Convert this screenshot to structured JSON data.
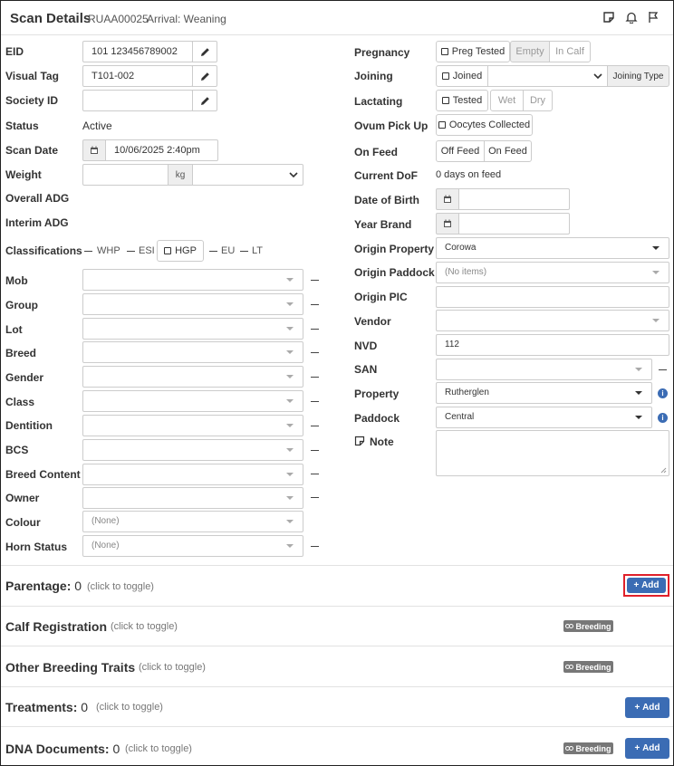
{
  "header": {
    "title": "Scan Details",
    "animal_id": "RUAA00025",
    "arrival": "Arrival: Weaning"
  },
  "left": {
    "eid": {
      "label": "EID",
      "value": "101 123456789002"
    },
    "visual_tag": {
      "label": "Visual Tag",
      "value": "T101-002"
    },
    "society_id": {
      "label": "Society ID",
      "value": ""
    },
    "status": {
      "label": "Status",
      "value": "Active"
    },
    "scan_date": {
      "label": "Scan Date",
      "value": "10/06/2025 2:40pm"
    },
    "weight": {
      "label": "Weight",
      "unit": "kg"
    },
    "overall_adg": {
      "label": "Overall ADG"
    },
    "interim_adg": {
      "label": "Interim ADG"
    },
    "classifications": {
      "label": "Classifications",
      "items": [
        "WHP",
        "ESI",
        "HGP",
        "EU",
        "LT"
      ]
    },
    "dropdowns": [
      {
        "label": "Mob",
        "value": ""
      },
      {
        "label": "Group",
        "value": ""
      },
      {
        "label": "Lot",
        "value": ""
      },
      {
        "label": "Breed",
        "value": ""
      },
      {
        "label": "Gender",
        "value": ""
      },
      {
        "label": "Class",
        "value": ""
      },
      {
        "label": "Dentition",
        "value": ""
      },
      {
        "label": "BCS",
        "value": ""
      },
      {
        "label": "Breed Content",
        "value": ""
      },
      {
        "label": "Owner",
        "value": ""
      },
      {
        "label": "Colour",
        "value": "(None)"
      },
      {
        "label": "Horn Status",
        "value": "(None)"
      }
    ]
  },
  "right": {
    "pregnancy": {
      "label": "Pregnancy",
      "check_label": "Preg Tested",
      "options": [
        "Empty",
        "In Calf"
      ]
    },
    "joining": {
      "label": "Joining",
      "check_label": "Joined",
      "type_button": "Joining Type"
    },
    "lactating": {
      "label": "Lactating",
      "check_label": "Tested",
      "options": [
        "Wet",
        "Dry"
      ]
    },
    "ovum": {
      "label": "Ovum Pick Up",
      "check_label": "Oocytes Collected"
    },
    "on_feed": {
      "label": "On Feed",
      "options": [
        "Off Feed",
        "On Feed"
      ]
    },
    "current_dof": {
      "label": "Current DoF",
      "value": "0 days on feed"
    },
    "dob": {
      "label": "Date of Birth",
      "value": ""
    },
    "year_brand": {
      "label": "Year Brand",
      "value": ""
    },
    "origin_property": {
      "label": "Origin Property",
      "value": "Corowa"
    },
    "origin_paddock": {
      "label": "Origin Paddock",
      "value": "(No items)"
    },
    "origin_pic": {
      "label": "Origin PIC",
      "value": ""
    },
    "vendor": {
      "label": "Vendor",
      "value": ""
    },
    "nvd": {
      "label": "NVD",
      "value": "112"
    },
    "san": {
      "label": "SAN",
      "value": ""
    },
    "property": {
      "label": "Property",
      "value": "Rutherglen"
    },
    "paddock": {
      "label": "Paddock",
      "value": "Central"
    },
    "note": {
      "label": "Note",
      "value": ""
    }
  },
  "sections": [
    {
      "title": "Parentage:",
      "count": "0",
      "toggle": "(click to toggle)",
      "badge": "",
      "add": "Add"
    },
    {
      "title": "Calf Registration",
      "count": "",
      "toggle": "(click to toggle)",
      "badge": "Breeding",
      "add": ""
    },
    {
      "title": "Other Breeding Traits",
      "count": "",
      "toggle": "(click to toggle)",
      "badge": "Breeding",
      "add": ""
    },
    {
      "title": "Treatments:",
      "count": "0",
      "toggle": "(click to toggle)",
      "badge": "",
      "add": "Add"
    },
    {
      "title": "DNA Documents:",
      "count": "0",
      "toggle": "(click to toggle)",
      "badge": "Breeding",
      "add": "Add"
    }
  ],
  "colors": {
    "accent": "#3b6cb4",
    "badge": "#777777",
    "highlight": "#e0202a"
  }
}
